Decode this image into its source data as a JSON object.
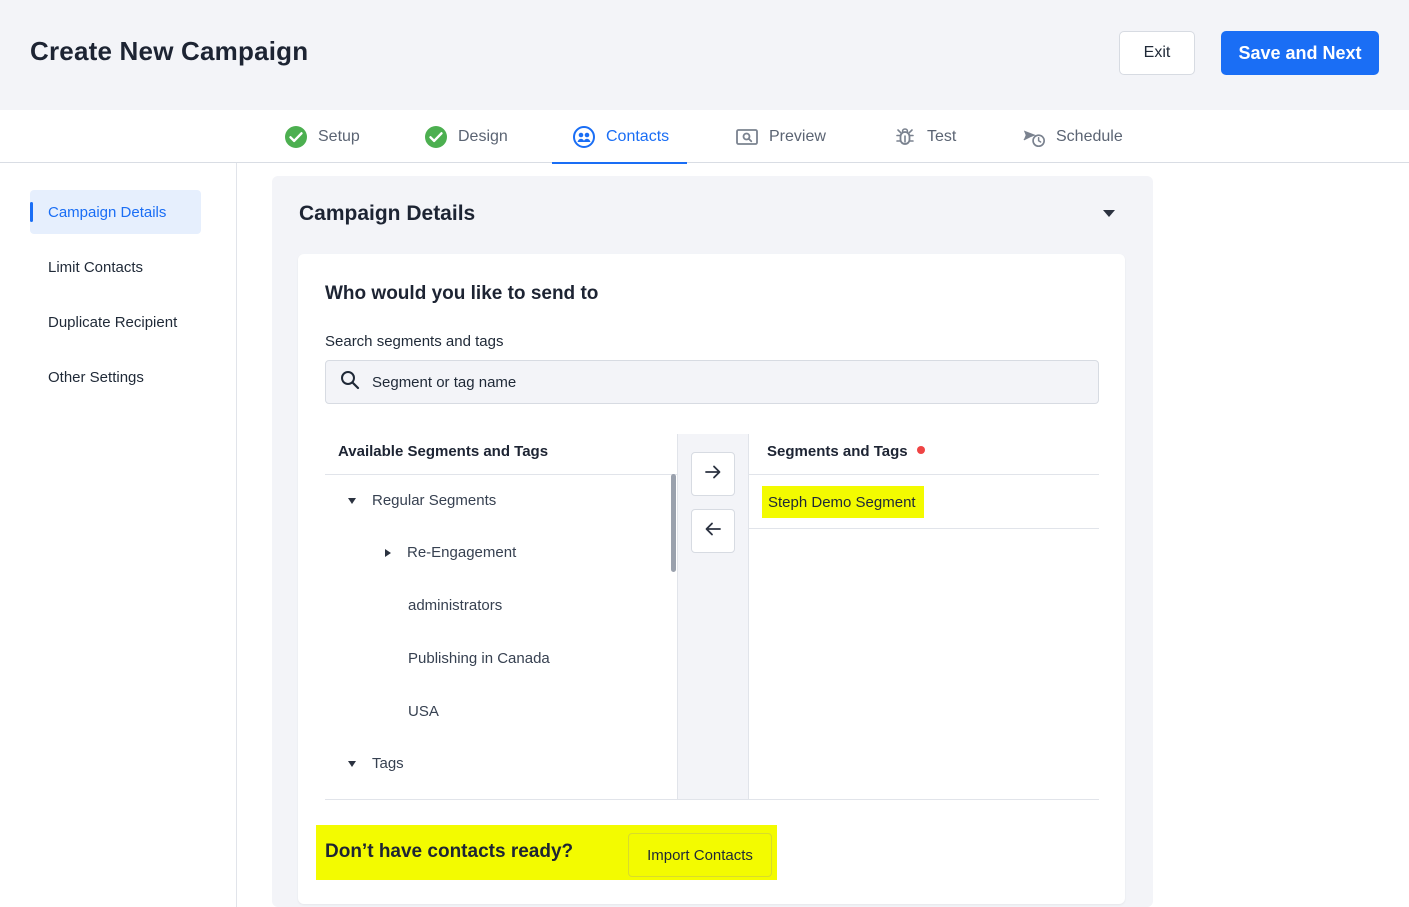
{
  "header": {
    "title": "Create New Campaign",
    "exit_label": "Exit",
    "save_label": "Save and Next"
  },
  "steps": [
    {
      "label": "Setup",
      "icon": "check-circle-icon",
      "state": "done"
    },
    {
      "label": "Design",
      "icon": "check-circle-icon",
      "state": "done"
    },
    {
      "label": "Contacts",
      "icon": "contacts-icon",
      "state": "active"
    },
    {
      "label": "Preview",
      "icon": "preview-icon",
      "state": "pending"
    },
    {
      "label": "Test",
      "icon": "bug-icon",
      "state": "pending"
    },
    {
      "label": "Schedule",
      "icon": "schedule-icon",
      "state": "pending"
    }
  ],
  "sidebar": {
    "items": [
      {
        "label": "Campaign Details",
        "active": true
      },
      {
        "label": "Limit Contacts",
        "active": false
      },
      {
        "label": "Duplicate Recipient",
        "active": false
      },
      {
        "label": "Other Settings",
        "active": false
      }
    ]
  },
  "section": {
    "title": "Campaign Details"
  },
  "audience": {
    "question": "Who would you like to send to",
    "search_label": "Search segments and tags",
    "search_placeholder": "Segment or tag name",
    "available_header": "Available Segments and Tags",
    "tree": [
      {
        "label": "Regular Segments",
        "level": 0,
        "toggle": "expanded"
      },
      {
        "label": "Re-Engagement",
        "level": 1,
        "toggle": "collapsed"
      },
      {
        "label": "administrators",
        "level": 1,
        "toggle": "none"
      },
      {
        "label": "Publishing in Canada",
        "level": 1,
        "toggle": "none"
      },
      {
        "label": "USA",
        "level": 1,
        "toggle": "none"
      },
      {
        "label": "Tags",
        "level": 0,
        "toggle": "expanded"
      }
    ],
    "selected_header": "Segments and Tags",
    "selected_items": [
      "Steph Demo Segment"
    ]
  },
  "import": {
    "prompt": "Don’t have contacts ready?",
    "button_label": "Import Contacts"
  },
  "colors": {
    "accent": "#1a6ef5",
    "done": "#4caf50",
    "highlight": "#f3fb00",
    "required": "#ef4444"
  }
}
